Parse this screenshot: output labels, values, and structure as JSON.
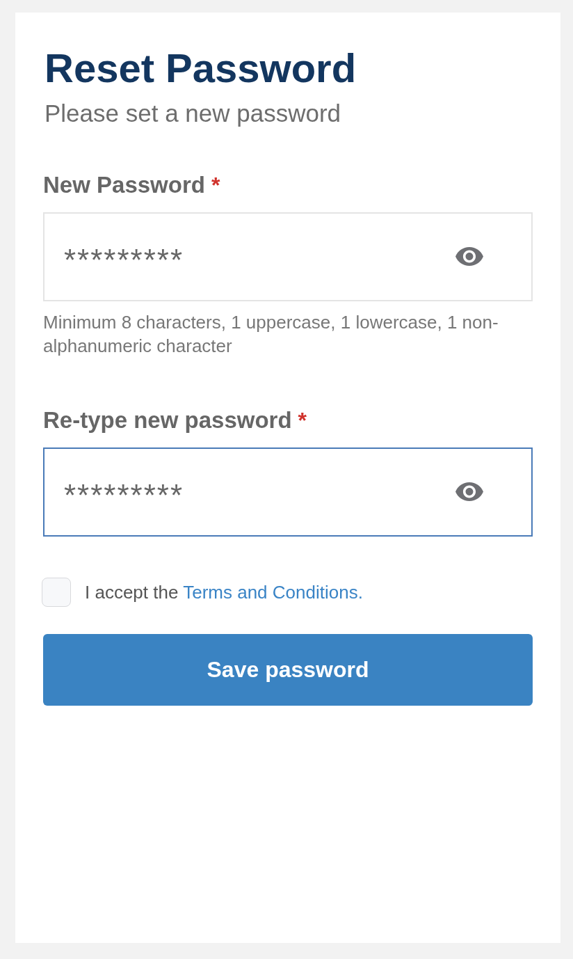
{
  "page": {
    "title": "Reset Password",
    "subtitle": "Please set a new password"
  },
  "fields": [
    {
      "label": "New Password",
      "required_mark": "*",
      "value": "*********",
      "focused": false,
      "hint": "Minimum 8 characters, 1 uppercase, 1 lowercase, 1 non-alphanumeric character"
    },
    {
      "label": "Re-type new password",
      "required_mark": "*",
      "value": "*********",
      "focused": true
    }
  ],
  "terms": {
    "checked": false,
    "text": "I accept the",
    "link": "Terms and Conditions."
  },
  "submit": {
    "label": "Save password"
  }
}
